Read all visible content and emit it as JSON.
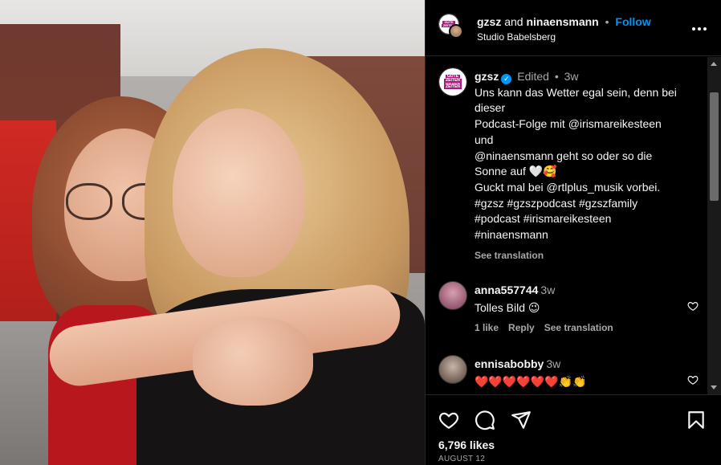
{
  "header": {
    "user1": "gzsz",
    "and": "and",
    "user2": "ninaensmann",
    "dot": "•",
    "follow": "Follow",
    "location": "Studio Babelsberg",
    "logo_text": [
      "GUTE",
      "ZEITEN",
      "SCHLECHTE",
      "ZEITEN"
    ]
  },
  "caption": {
    "username": "gzsz",
    "verified_mark": "✓",
    "edited": "Edited",
    "dot": "•",
    "time": "3w",
    "lines": [
      "Uns kann das Wetter egal sein, denn bei",
      "dieser",
      "Podcast-Folge mit @irismareikesteen",
      "und",
      "@ninaensmann geht so oder so die",
      "Sonne auf 🤍🥰",
      "Guckt mal bei @rtlplus_musik vorbei.",
      "#gzsz #gzszpodcast #gzszfamily",
      "#podcast #irismareikesteen",
      "#ninaensmann"
    ],
    "see_translation": "See translation"
  },
  "comments": [
    {
      "username": "anna557744",
      "time": "3w",
      "text": "Tolles Bild 😉",
      "likes": "1 like",
      "reply": "Reply",
      "see_translation": "See translation"
    },
    {
      "username": "ennisabobby",
      "time": "3w",
      "text": "❤️❤️❤️❤️❤️❤️👏👏"
    }
  ],
  "footer": {
    "likes": "6,796 likes",
    "date": "AUGUST 12"
  },
  "icons": [
    "more-icon",
    "verified-icon",
    "heart-icon",
    "comment-icon",
    "share-icon",
    "save-icon"
  ],
  "colors": {
    "background": "#000000",
    "text": "#f5f5f5",
    "secondary": "#a8a8a8",
    "link": "#0095f6",
    "divider": "#262626"
  }
}
